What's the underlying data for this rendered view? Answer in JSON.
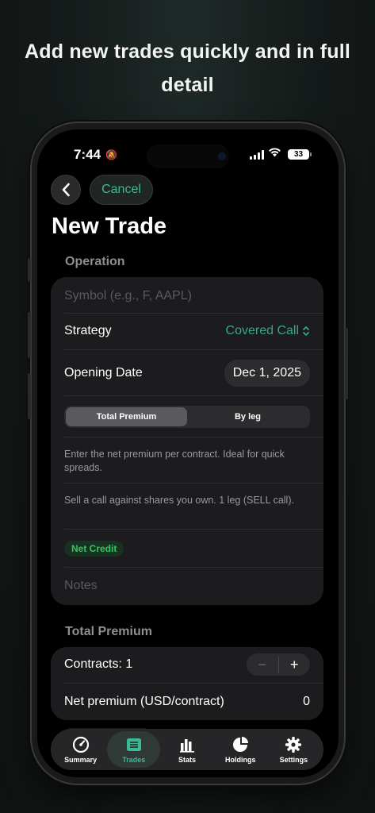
{
  "headline": "Add new trades quickly and in full detail",
  "status_bar": {
    "time": "7:44",
    "battery": "33"
  },
  "nav": {
    "cancel_label": "Cancel"
  },
  "page_title": "New Trade",
  "operation": {
    "section_label": "Operation",
    "symbol_placeholder": "Symbol (e.g., F, AAPL)",
    "strategy_label": "Strategy",
    "strategy_value": "Covered Call",
    "opening_date_label": "Opening Date",
    "opening_date_value": "Dec 1, 2025",
    "mode_options": [
      "Total Premium",
      "By leg"
    ],
    "mode_selected": "Total Premium",
    "mode_help": "Enter the net premium per contract. Ideal for quick spreads.",
    "strategy_help": "Sell a call against shares you own. 1 leg (SELL call).",
    "badge": "Net Credit",
    "notes_placeholder": "Notes"
  },
  "total_premium": {
    "section_label": "Total Premium",
    "contracts_label": "Contracts: 1",
    "net_premium_label": "Net premium (USD/contract)",
    "net_premium_value": "0"
  },
  "tabbar": {
    "items": [
      {
        "label": "Summary",
        "icon": "gauge-icon"
      },
      {
        "label": "Trades",
        "icon": "list-icon"
      },
      {
        "label": "Stats",
        "icon": "bar-chart-icon"
      },
      {
        "label": "Holdings",
        "icon": "pie-chart-icon"
      },
      {
        "label": "Settings",
        "icon": "gear-icon"
      }
    ],
    "active": "Trades"
  },
  "colors": {
    "accent": "#3fb898",
    "credit": "#34c759"
  }
}
